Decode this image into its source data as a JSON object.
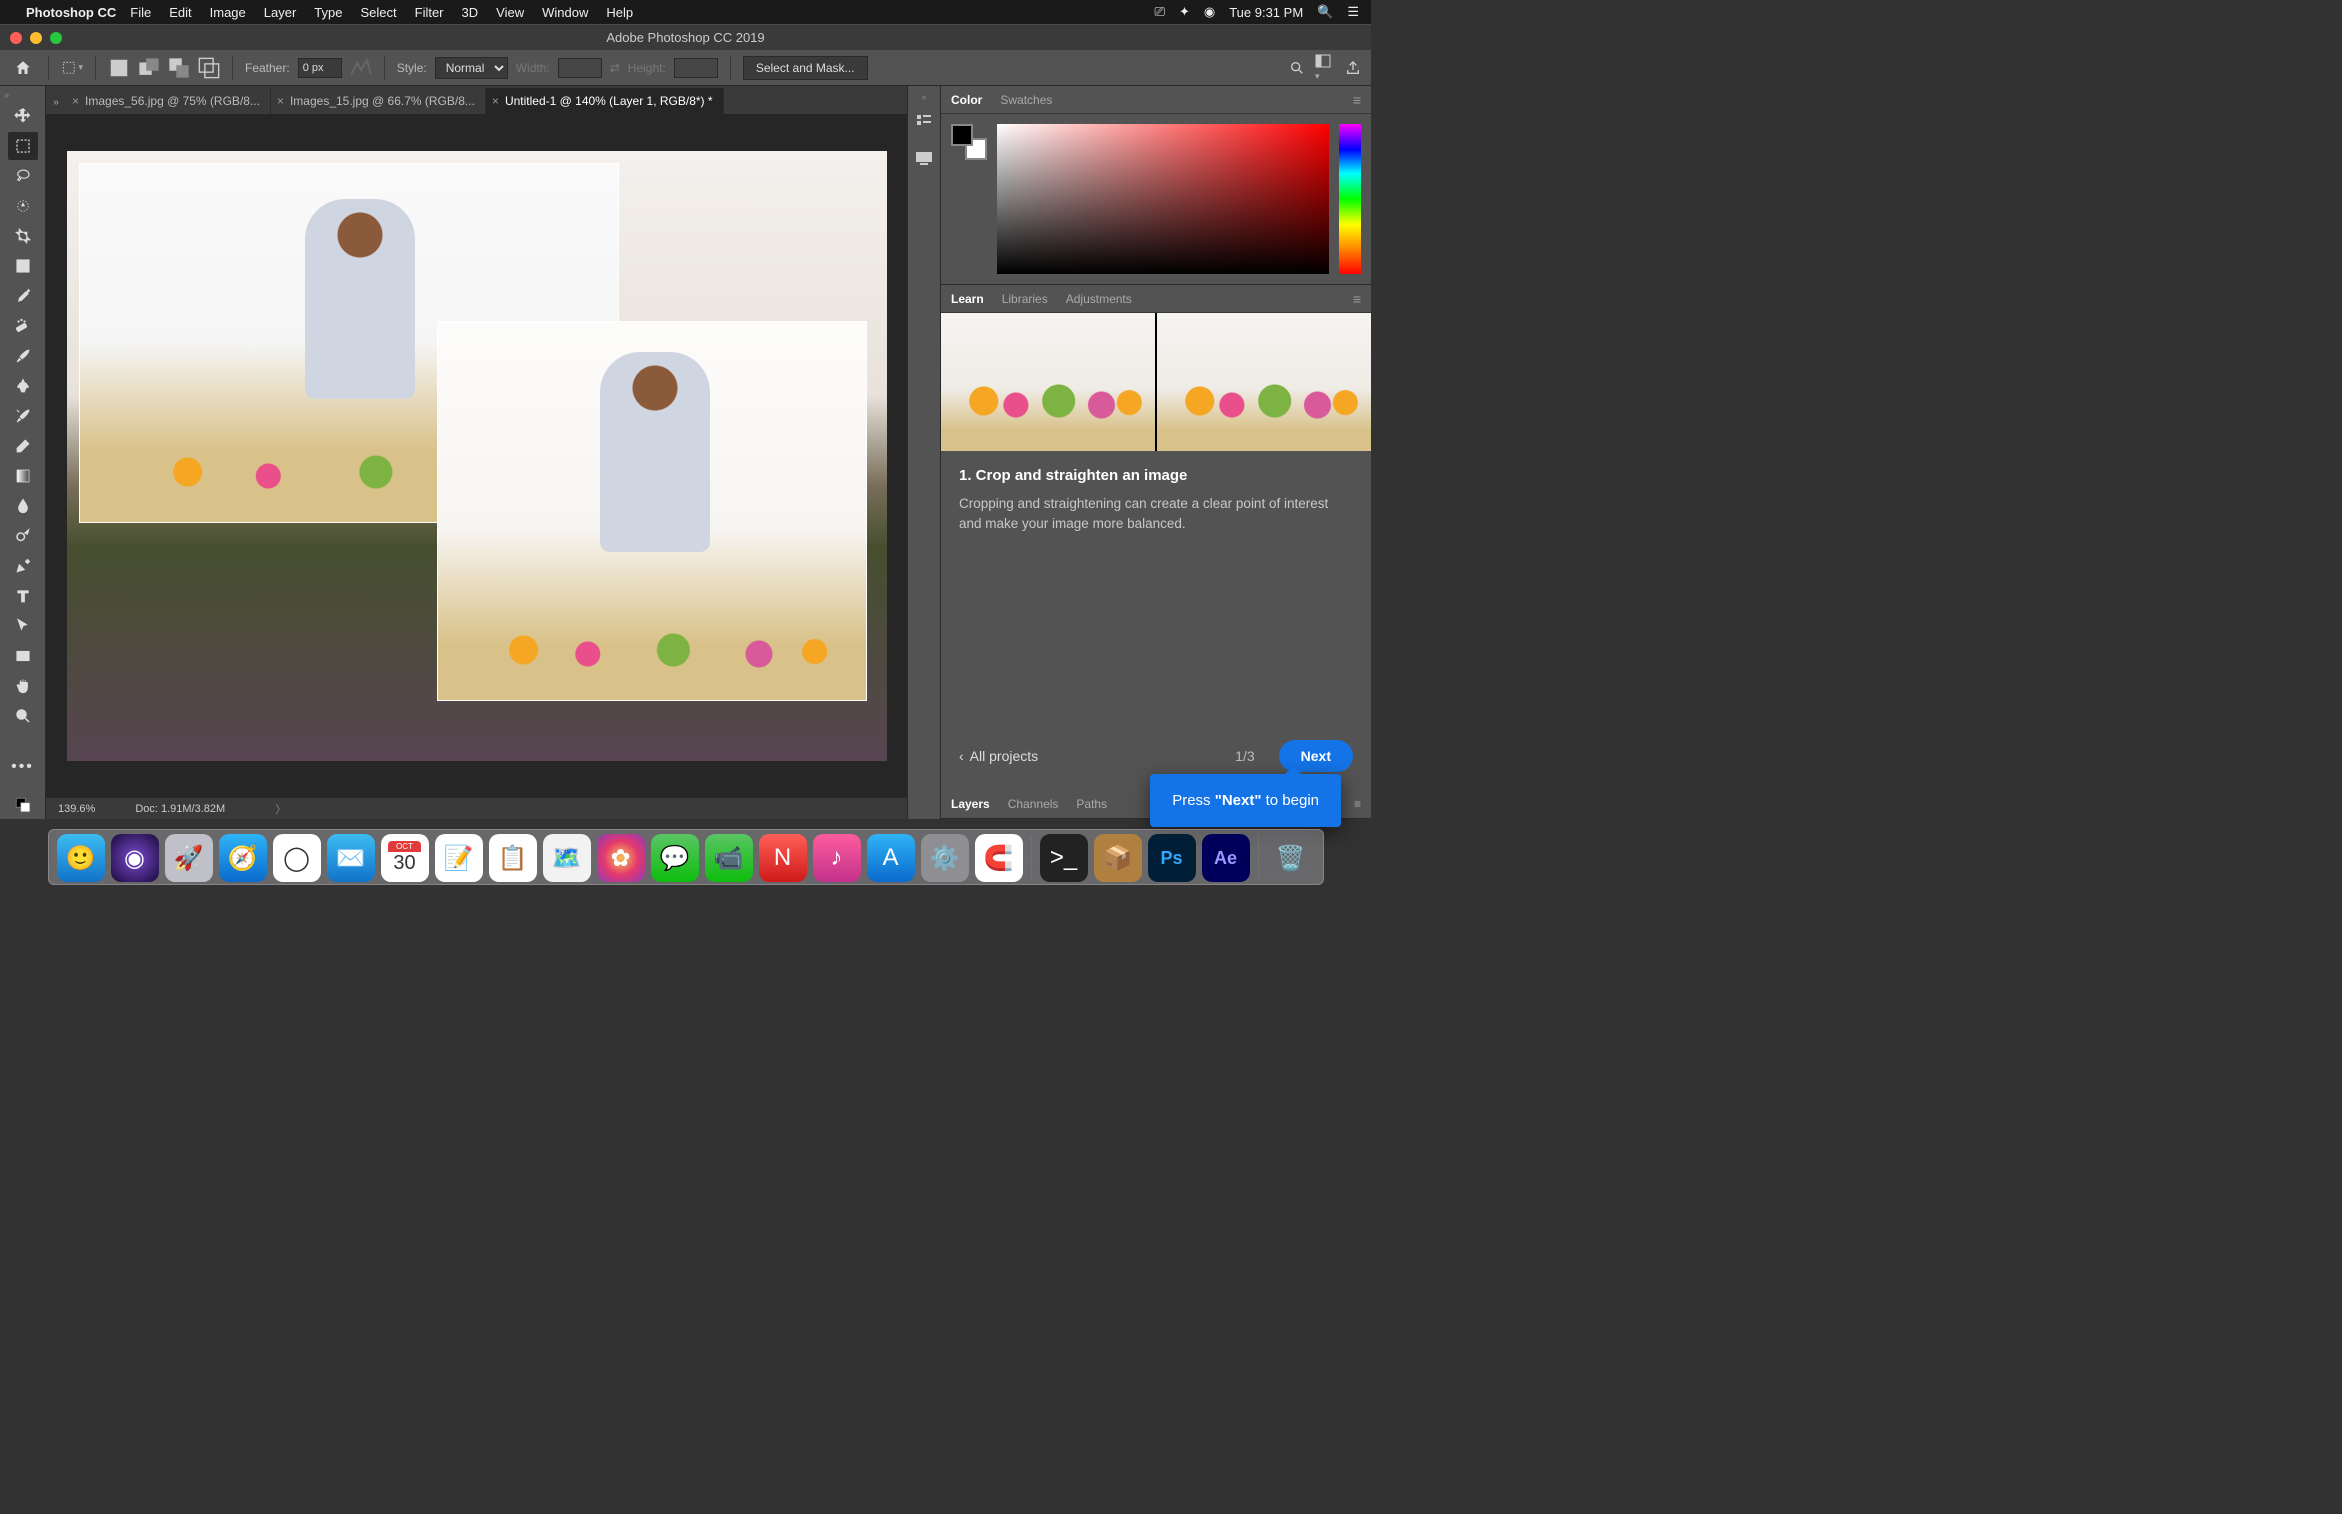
{
  "menubar": {
    "app": "Photoshop CC",
    "items": [
      "File",
      "Edit",
      "Image",
      "Layer",
      "Type",
      "Select",
      "Filter",
      "3D",
      "View",
      "Window",
      "Help"
    ],
    "clock": "Tue 9:31 PM"
  },
  "window": {
    "title": "Adobe Photoshop CC 2019"
  },
  "options": {
    "feather_label": "Feather:",
    "feather_value": "0 px",
    "style_label": "Style:",
    "style_value": "Normal",
    "width_label": "Width:",
    "height_label": "Height:",
    "select_mask": "Select and Mask..."
  },
  "tabs": [
    {
      "label": "Images_56.jpg @ 75% (RGB/8...",
      "active": false
    },
    {
      "label": "Images_15.jpg @ 66.7% (RGB/8...",
      "active": false
    },
    {
      "label": "Untitled-1 @ 140% (Layer 1, RGB/8*) *",
      "active": true
    }
  ],
  "status": {
    "zoom": "139.6%",
    "doc": "Doc: 1.91M/3.82M"
  },
  "colorpanel": {
    "tabs": [
      "Color",
      "Swatches"
    ]
  },
  "learnpanel": {
    "tabs": [
      "Learn",
      "Libraries",
      "Adjustments"
    ],
    "title": "1.  Crop and straighten an image",
    "body": "Cropping and straightening can create a clear point of interest and make your image more balanced.",
    "all": "All projects",
    "count": "1/3",
    "next": "Next"
  },
  "bottom_tabs": [
    "Layers",
    "Channels",
    "Paths"
  ],
  "coach": {
    "pre": "Press ",
    "bold": "\"Next\"",
    "post": " to begin"
  },
  "dock_apps": [
    "finder",
    "siri",
    "launchpad",
    "safari",
    "chrome",
    "mail",
    "calendar",
    "notes",
    "reminders",
    "maps",
    "photos",
    "messages",
    "facetime",
    "news",
    "music",
    "appstore",
    "sysprefs",
    "magnet",
    "terminal",
    "archive",
    "photoshop",
    "afterfx",
    "trash"
  ],
  "calendar_day": "30"
}
